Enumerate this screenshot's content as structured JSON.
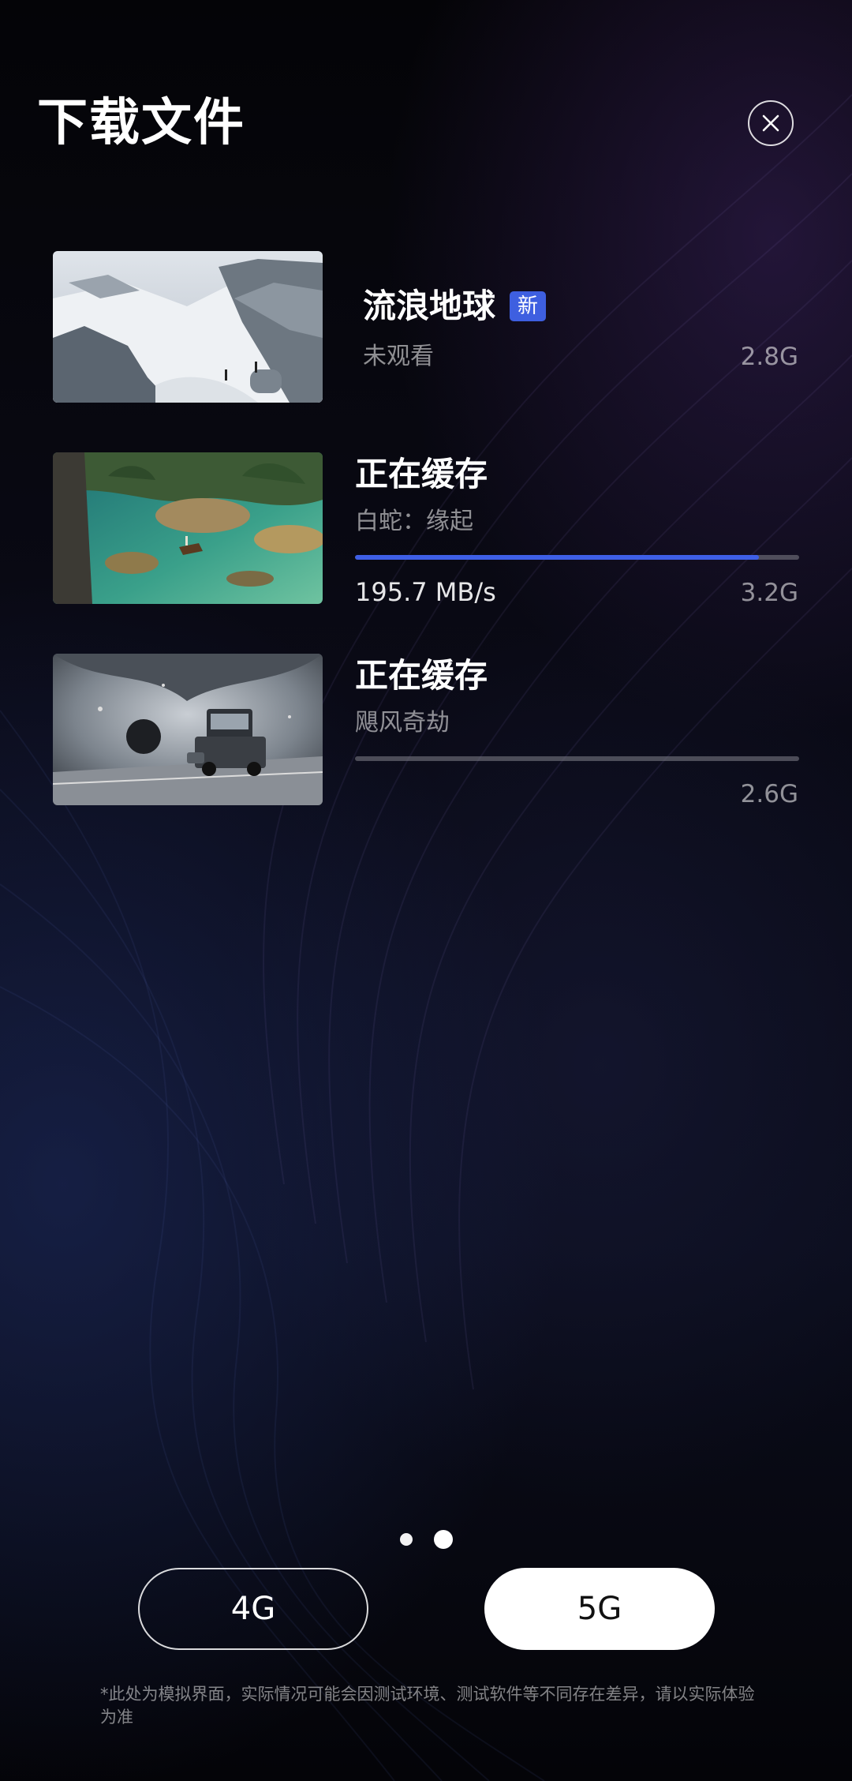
{
  "page": {
    "title": "下载文件"
  },
  "close": {
    "icon": "close-icon"
  },
  "items": [
    {
      "title": "流浪地球",
      "badge": "新",
      "subtitle": "未观看",
      "size": "2.8G",
      "thumbnail": "snowy-cliff-thumbnail"
    },
    {
      "title": "正在缓存",
      "subtitle": "白蛇：缘起",
      "speed": "195.7 MB/s",
      "size": "3.2G",
      "progress": 0.91,
      "thumbnail": "lake-village-thumbnail"
    },
    {
      "title": "正在缓存",
      "subtitle": "飓风奇劫",
      "size": "2.6G",
      "progress": 0,
      "thumbnail": "storm-truck-thumbnail"
    }
  ],
  "pagination": {
    "count": 2,
    "active": 2
  },
  "network": {
    "option_4g": "4G",
    "option_5g": "5G",
    "selected": "5G"
  },
  "disclaimer": "*此处为模拟界面，实际情况可能会因测试环境、测试软件等不同存在差异，请以实际体验为准",
  "colors": {
    "accent": "#3e5fe6",
    "background": "#05050a",
    "track": "#787882"
  }
}
